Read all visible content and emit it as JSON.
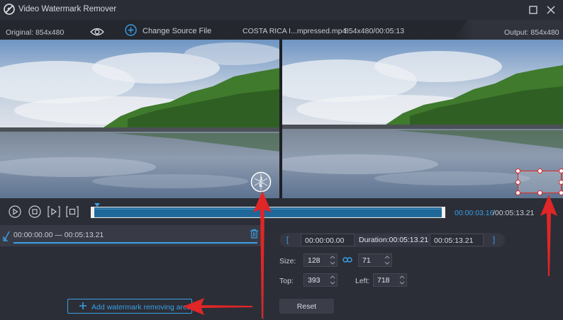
{
  "app": {
    "title": "Video Watermark Remover"
  },
  "infobar": {
    "original_label": "Original: 854x480",
    "change_source_label": "Change Source File",
    "file_name": "COSTA RICA I...mpressed.mp4",
    "file_meta": "854x480/00:05:13",
    "output_label": "Output: 854x480"
  },
  "transport": {
    "current_time": "00:00:03.16",
    "total_time": "/00:05:13.21"
  },
  "segment": {
    "range": "00:00:00.00 — 00:05:13.21"
  },
  "add_area_label": "Add watermark removing area",
  "editor": {
    "bracket_open": "[",
    "bracket_close": "]",
    "start_time": "00:00:00.00",
    "duration": "Duration:00:05:13.21",
    "end_time": "00:05:13.21",
    "size_label": "Size:",
    "width": "128",
    "height": "71",
    "top_label": "Top:",
    "top": "393",
    "left_label": "Left:",
    "left": "718",
    "reset_label": "Reset"
  },
  "colors": {
    "accent": "#3aa0e8",
    "annotation": "#e02626",
    "background": "#2b2e36"
  },
  "icons": [
    "app-logo-icon",
    "maximize-icon",
    "close-icon",
    "eye-icon",
    "plus-circle-icon",
    "play-icon",
    "stop-icon",
    "next-frame-icon",
    "clip-icon",
    "range-marker-icon",
    "trash-icon",
    "plus-icon",
    "link-icon",
    "watermark-logo-icon"
  ]
}
